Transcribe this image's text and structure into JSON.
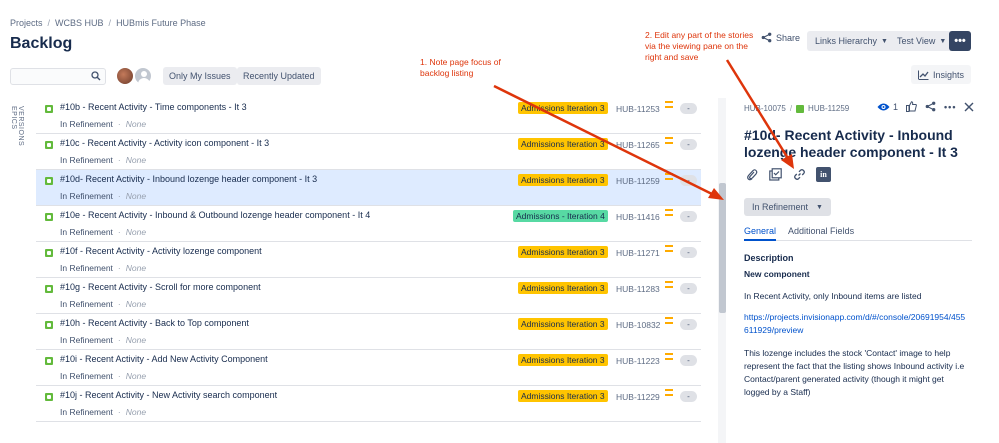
{
  "breadcrumbs": [
    "Projects",
    "WCBS HUB",
    "HUBmis Future Phase"
  ],
  "page_title": "Backlog",
  "top_actions": {
    "share": "Share",
    "links_hierarchy": "Links Hierarchy",
    "test_view": "Test View",
    "more": "•••"
  },
  "filters": {
    "search_placeholder": "",
    "only_my_issues": "Only My Issues",
    "recently_updated": "Recently Updated",
    "insights": "Insights"
  },
  "side_rail": [
    "VERSIONS",
    "EPICS"
  ],
  "issues": [
    {
      "summary": "#10b - Recent Activity - Time components - It 3",
      "status": "In Refinement",
      "assignee": "None",
      "sprint": "Admissions Iteration 3",
      "key": "HUB-11253",
      "estimate": "-"
    },
    {
      "summary": "#10c - Recent Activity - Activity icon component - It 3",
      "status": "In Refinement",
      "assignee": "None",
      "sprint": "Admissions Iteration 3",
      "key": "HUB-11265",
      "estimate": "-"
    },
    {
      "summary": "#10d- Recent Activity - Inbound lozenge header component - It 3",
      "status": "In Refinement",
      "assignee": "None",
      "sprint": "Admissions Iteration 3",
      "key": "HUB-11259",
      "estimate": "-"
    },
    {
      "summary": "#10e - Recent Activity - Inbound & Outbound lozenge header component - It 4",
      "status": "In Refinement",
      "assignee": "None",
      "sprint": "Admissions - Iteration 4",
      "key": "HUB-11416",
      "estimate": "-"
    },
    {
      "summary": "#10f - Recent Activity - Activity lozenge component",
      "status": "In Refinement",
      "assignee": "None",
      "sprint": "Admissions Iteration 3",
      "key": "HUB-11271",
      "estimate": "-"
    },
    {
      "summary": "#10g - Recent Activity - Scroll for more component",
      "status": "In Refinement",
      "assignee": "None",
      "sprint": "Admissions Iteration 3",
      "key": "HUB-11283",
      "estimate": "-"
    },
    {
      "summary": "#10h - Recent Activity - Back to Top component",
      "status": "In Refinement",
      "assignee": "None",
      "sprint": "Admissions Iteration 3",
      "key": "HUB-10832",
      "estimate": "-"
    },
    {
      "summary": "#10i - Recent Activity - Add New Activity Component",
      "status": "In Refinement",
      "assignee": "None",
      "sprint": "Admissions Iteration 3",
      "key": "HUB-11223",
      "estimate": "-"
    },
    {
      "summary": "#10j - Recent Activity - New Activity search component",
      "status": "In Refinement",
      "assignee": "None",
      "sprint": "Admissions Iteration 3",
      "key": "HUB-11229",
      "estimate": "-"
    }
  ],
  "colors": {
    "sprint_iteration_3": "#ffc400",
    "sprint_iteration_4": "#57d9a3",
    "selected_row": "#deebff",
    "annotation": "#de350b"
  },
  "detail": {
    "parent_key": "HUB-10075",
    "issue_key": "HUB-11259",
    "watch_count": "1",
    "title": "#10d- Recent Activity - Inbound lozenge header component - It 3",
    "status": "In Refinement",
    "tabs": [
      "General",
      "Additional Fields"
    ],
    "description_label": "Description",
    "heading": "New component",
    "para1": "In Recent Activity, only Inbound items are listed",
    "link": "https://projects.invisionapp.com/d/#/console/20691954/455611929/preview",
    "para2": "This lozenge includes the stock 'Contact' image to help represent the fact that the listing shows Inbound activity i.e Contact/parent generated activity (though it might get logged by a Staff)"
  },
  "annotations": {
    "note1": [
      "1. Note page focus of",
      "backlog listing"
    ],
    "note2": [
      "2. Edit any part of the stories",
      "via the viewing pane on the",
      "right and save"
    ]
  }
}
